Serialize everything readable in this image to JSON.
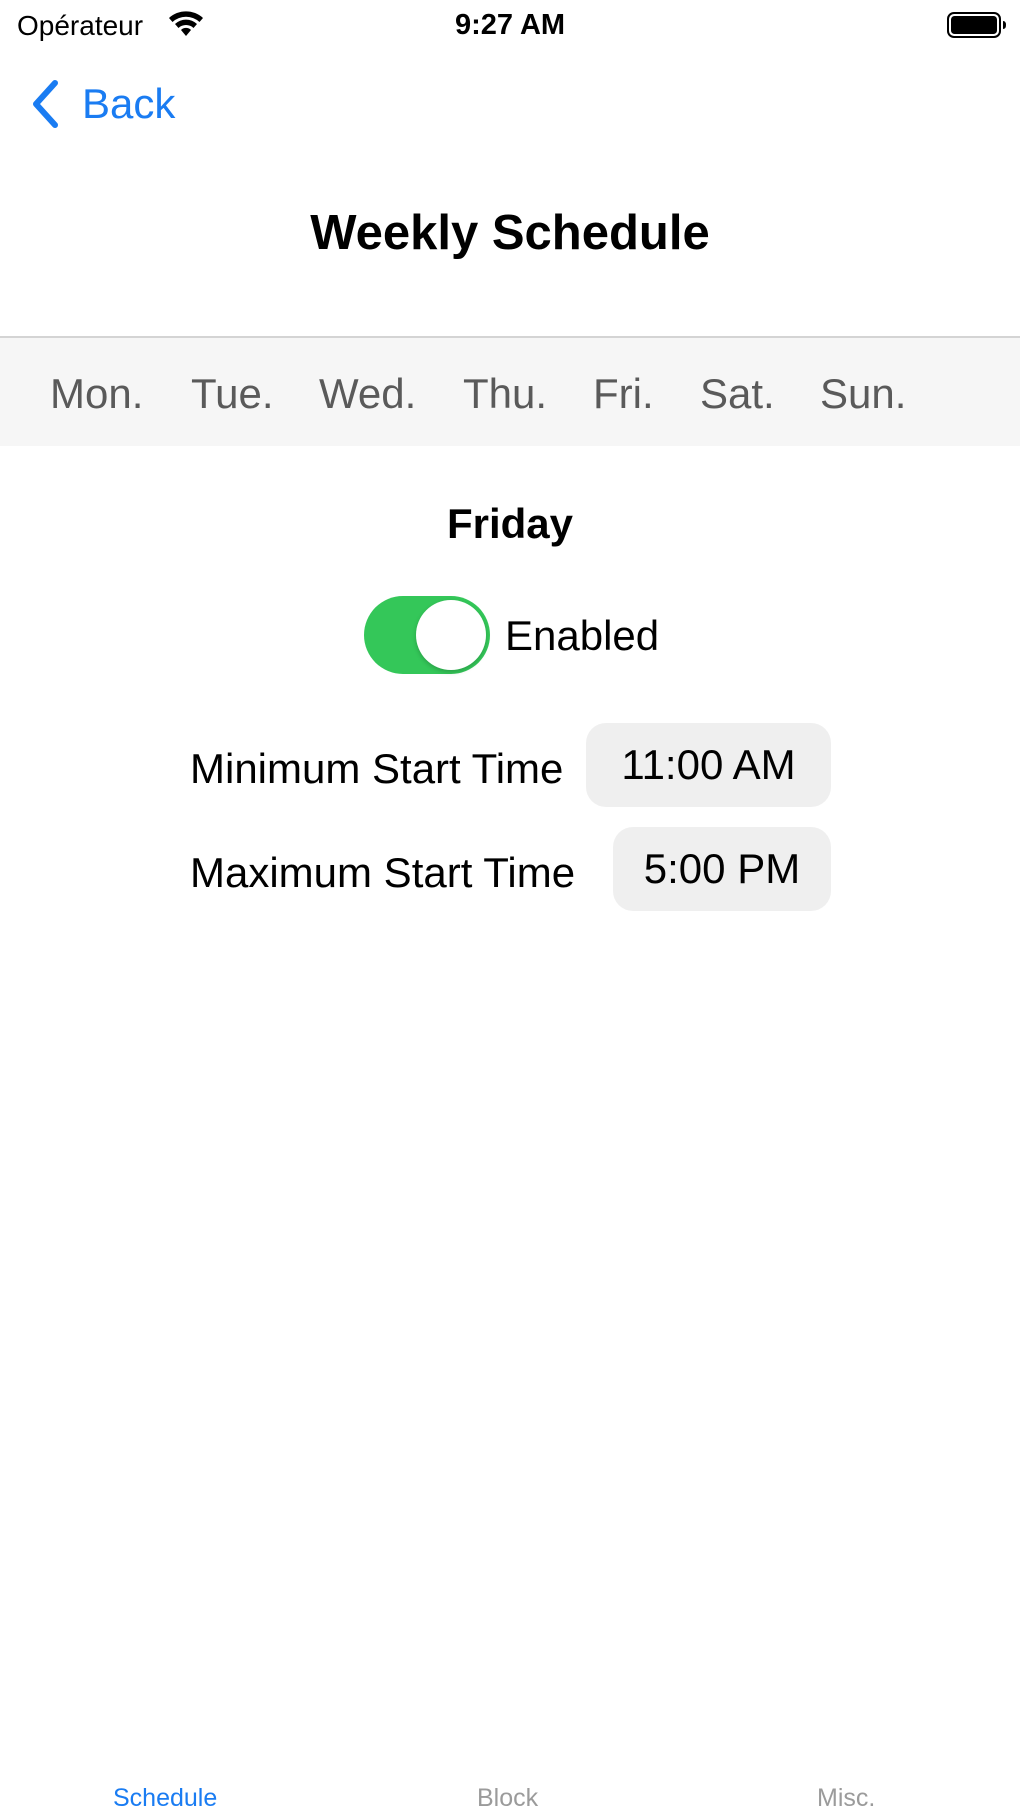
{
  "status_bar": {
    "carrier": "Opérateur",
    "time": "9:27 AM",
    "wifi_icon": "wifi-icon",
    "battery_icon": "battery-full-icon"
  },
  "nav": {
    "back_label": "Back",
    "back_icon": "chevron-left-icon",
    "title": "Weekly Schedule"
  },
  "days": [
    {
      "label": "Mon."
    },
    {
      "label": "Tue."
    },
    {
      "label": "Wed."
    },
    {
      "label": "Thu."
    },
    {
      "label": "Fri."
    },
    {
      "label": "Sat."
    },
    {
      "label": "Sun."
    }
  ],
  "selected_day": {
    "heading": "Friday",
    "enabled": true,
    "enabled_label": "Enabled",
    "min_start_label": "Minimum Start Time",
    "min_start_value": "11:00 AM",
    "max_start_label": "Maximum Start Time",
    "max_start_value": "5:00 PM"
  },
  "tab_bar": {
    "items": [
      {
        "label": "Schedule",
        "active": true
      },
      {
        "label": "Block",
        "active": false
      },
      {
        "label": "Misc.",
        "active": false
      }
    ]
  },
  "colors": {
    "accent": "#1a7cf2",
    "toggle_on": "#34c759",
    "inactive_tab": "#9b9b9b",
    "day_tab_text": "#5a5a5a"
  }
}
